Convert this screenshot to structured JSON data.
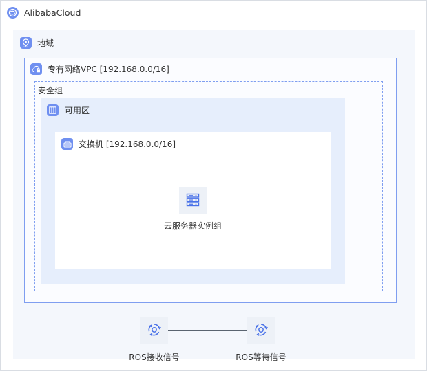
{
  "cloud": {
    "title": "AlibabaCloud"
  },
  "region": {
    "label": "地域"
  },
  "vpc": {
    "label": "专有网络VPC [192.168.0.0/16]"
  },
  "security_group": {
    "label": "安全组"
  },
  "zone": {
    "label": "可用区"
  },
  "vswitch": {
    "label": "交换机 [192.168.0.0/16]"
  },
  "ecs_group": {
    "label": "云服务器实例组"
  },
  "ros_receive": {
    "label": "ROS接收信号"
  },
  "ros_wait": {
    "label": "ROS等待信号"
  },
  "colors": {
    "accent": "#6f8ff0",
    "border": "#7f9ef0",
    "zone_bg": "#e6eefc",
    "region_bg": "#f4f7fc"
  },
  "icons": {
    "cloud": "alibaba-cloud-icon",
    "region": "location-pin-icon",
    "vpc": "cloud-lock-icon",
    "zone": "grid-icon",
    "vswitch": "switch-icon",
    "ecs": "server-icon",
    "ros": "ros-cycle-icon"
  }
}
